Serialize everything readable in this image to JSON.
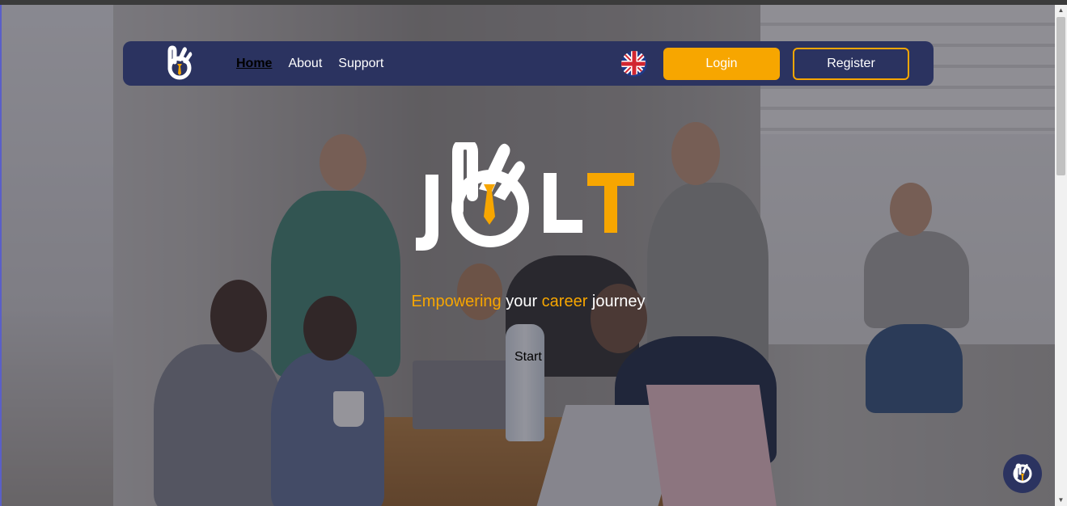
{
  "nav": {
    "links": [
      {
        "label": "Home",
        "active": true
      },
      {
        "label": "About",
        "active": false
      },
      {
        "label": "Support",
        "active": false
      }
    ],
    "language_icon": "uk-flag-icon",
    "login_label": "Login",
    "register_label": "Register"
  },
  "hero": {
    "logo_text": "JOLT",
    "tagline": [
      {
        "text": "Empowering",
        "accent": true
      },
      {
        "text": " your ",
        "accent": false
      },
      {
        "text": "career",
        "accent": true
      },
      {
        "text": " journey",
        "accent": false
      }
    ],
    "start_label": "Start"
  },
  "chat": {
    "icon": "chat-assistant-icon"
  },
  "colors": {
    "navbar": "#2b3360",
    "accent": "#f7a600",
    "text": "#ffffff"
  }
}
